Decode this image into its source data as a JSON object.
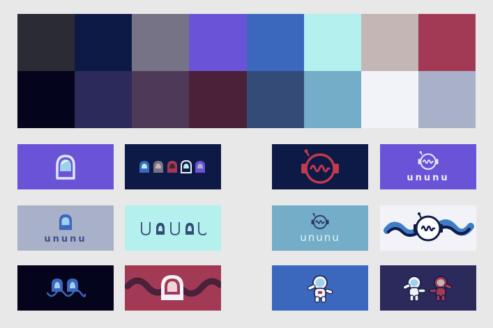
{
  "palette": {
    "swatches": [
      "#2a2b34",
      "#0d1a45",
      "#777386",
      "#6a53d6",
      "#3b67bd",
      "#b3f0ee",
      "#c3b6b4",
      "#a33a55",
      "#04041c",
      "#2b2a5a",
      "#4e3a58",
      "#4a2139",
      "#354b77",
      "#73adc8",
      "#f1f3f8",
      "#a9b1c8"
    ]
  },
  "cards": [
    {
      "id": "helmet-purple",
      "bg": "#6a53d6",
      "icon": "helmet-icon"
    },
    {
      "id": "helmet-row-navy",
      "bg": "#0d1a45",
      "icon": "helmet-row-icon"
    },
    {
      "id": "radio-helmet-navy",
      "bg": "#0d1a45",
      "icon": "radio-helmet-icon"
    },
    {
      "id": "ununu-logo-purple",
      "bg": "#6a53d6",
      "icon": "radio-helmet-icon",
      "wordmark": "ununu"
    },
    {
      "id": "ununu-logo-grey",
      "bg": "#a9b1c8",
      "icon": "helmet-icon",
      "wordmark": "ununu"
    },
    {
      "id": "ununu-helmet-letters",
      "bg": "#b3f0ee",
      "icon": "helmet-letters-icon"
    },
    {
      "id": "ununu-logo-skyblue",
      "bg": "#73adc8",
      "icon": "radio-helmet-icon",
      "wordmark": "ununu"
    },
    {
      "id": "wave-radio-white",
      "bg": "#f1f3f8",
      "icon": "wave-radio-helmet-icon"
    },
    {
      "id": "twin-helmet-navy",
      "bg": "#04041c",
      "icon": "twin-helmet-wave-icon"
    },
    {
      "id": "wave-helmet-red",
      "bg": "#a33a55",
      "icon": "wave-helmet-icon"
    },
    {
      "id": "astronaut-blue",
      "bg": "#3b67bd",
      "icon": "astronaut-icon"
    },
    {
      "id": "astronaut-pair-indigo",
      "bg": "#2b2a5a",
      "icon": "astronaut-pair-icon"
    }
  ],
  "wordmarks": {
    "purple": "ununu",
    "grey": "ununu",
    "skyblue": "ununu"
  }
}
